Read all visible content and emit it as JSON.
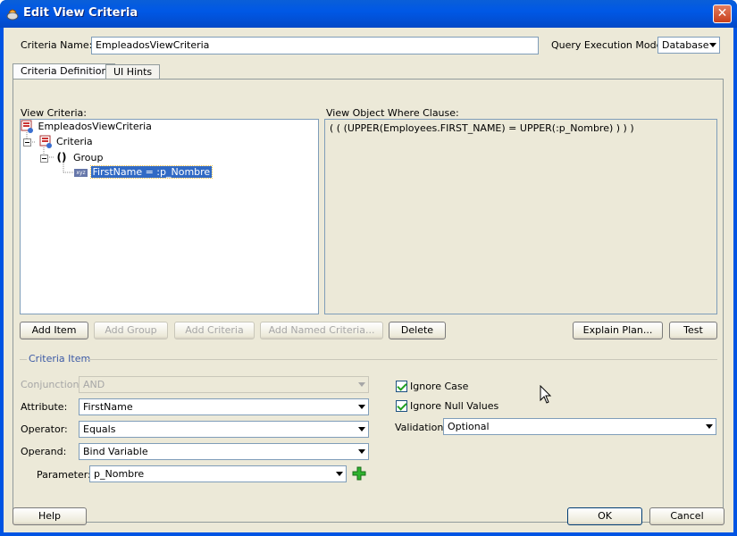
{
  "window": {
    "title": "Edit View Criteria",
    "close_glyph": "✕"
  },
  "header": {
    "criteria_name_label": "Criteria Name:",
    "criteria_name_value": "EmpleadosViewCriteria",
    "query_mode_label": "Query Execution Mode:",
    "query_mode_value": "Database"
  },
  "tabs": [
    {
      "label": "Criteria Definition"
    },
    {
      "label": "UI Hints"
    }
  ],
  "view_criteria": {
    "label": "View Criteria:",
    "tree": [
      {
        "label": "EmpleadosViewCriteria"
      },
      {
        "label": "Criteria"
      },
      {
        "label": "()",
        "sub": "Group"
      },
      {
        "label": "FirstName = :p_Nombre",
        "badge": "xyz"
      }
    ]
  },
  "where_clause": {
    "label": "View Object Where Clause:",
    "text": "( ( (UPPER(Employees.FIRST_NAME) = UPPER(:p_Nombre) ) ) )"
  },
  "buttons": {
    "add_item": "Add Item",
    "add_group": "Add Group",
    "add_criteria": "Add Criteria",
    "add_named_criteria": "Add Named Criteria...",
    "delete": "Delete",
    "explain_plan": "Explain Plan...",
    "test": "Test",
    "help": "Help",
    "ok": "OK",
    "cancel": "Cancel"
  },
  "criteria_item": {
    "section_label": "Criteria Item",
    "conjunction_label": "Conjunction:",
    "conjunction_value": "AND",
    "attribute_label": "Attribute:",
    "attribute_value": "FirstName",
    "operator_label": "Operator:",
    "operator_value": "Equals",
    "operand_label": "Operand:",
    "operand_value": "Bind Variable",
    "parameter_label": "Parameter:",
    "parameter_value": "p_Nombre",
    "ignore_case_label": "Ignore Case",
    "ignore_case_checked": true,
    "ignore_null_label": "Ignore Null Values",
    "ignore_null_checked": true,
    "validation_label": "Validation:",
    "validation_value": "Optional"
  },
  "colors": {
    "title_bar": "#0058e6",
    "dialog_bg": "#ece9d8",
    "selection": "#316ac5",
    "section_label": "#3c5aa6"
  }
}
